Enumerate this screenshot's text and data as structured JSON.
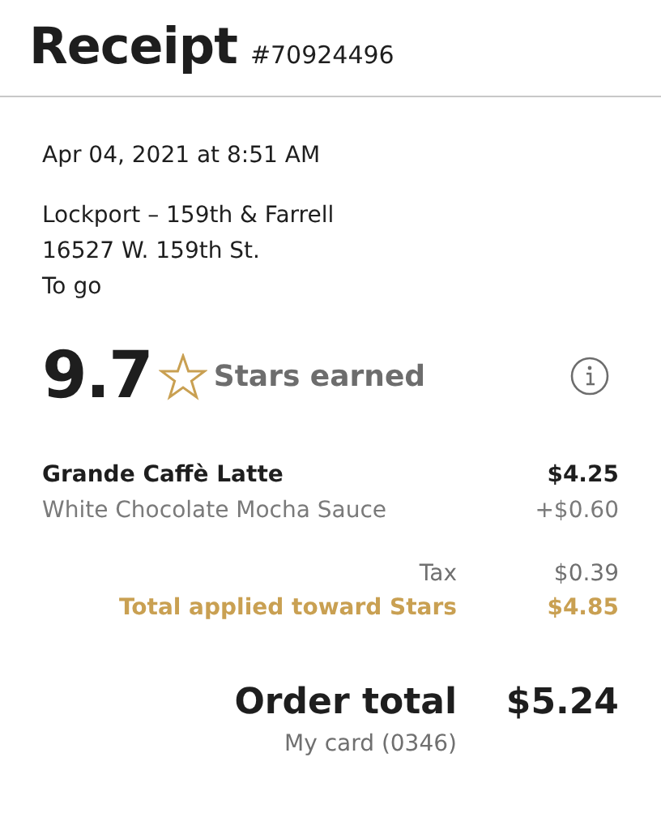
{
  "header": {
    "title": "Receipt",
    "number": "#70924496"
  },
  "date": "Apr 04, 2021 at 8:51 AM",
  "store": {
    "lines": [
      "Lockport – 159th & Farrell",
      "16527 W. 159th St.",
      "To go"
    ]
  },
  "stars": {
    "value": "9.7",
    "label": "Stars earned"
  },
  "items": [
    {
      "name": "Grande Caffè Latte",
      "price": "$4.25",
      "kind": "main"
    },
    {
      "name": "White Chocolate Mocha Sauce",
      "price": "+$0.60",
      "kind": "addon"
    }
  ],
  "summary": [
    {
      "label": "Tax",
      "amount": "$0.39",
      "kind": "regular"
    },
    {
      "label": "Total applied toward Stars",
      "amount": "$4.85",
      "kind": "highlight"
    }
  ],
  "total": {
    "label": "Order total",
    "amount": "$5.24",
    "payment": "My card (0346)"
  }
}
